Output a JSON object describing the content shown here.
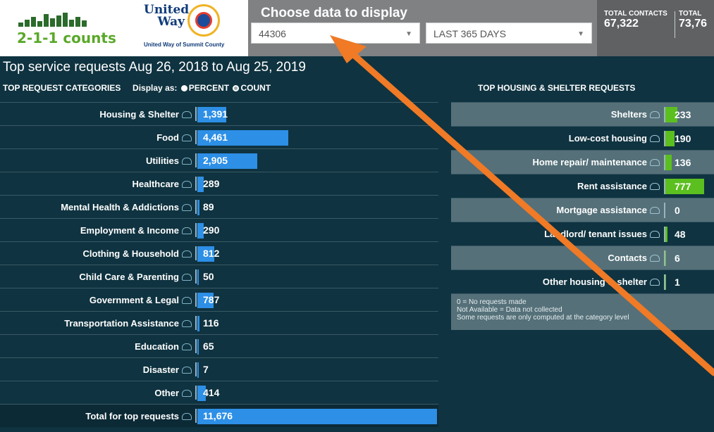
{
  "header": {
    "logo_text": "2-1-1 counts",
    "uw_line1": "United",
    "uw_line2": "Way",
    "uw_sub": "United Way of Summit County",
    "choose_title": "Choose data to display",
    "zip_value": "44306",
    "period_value": "LAST 365 DAYS",
    "totals": [
      {
        "label": "TOTAL CONTACTS",
        "value": "67,322"
      },
      {
        "label": "TOTAL",
        "value": "73,76"
      }
    ]
  },
  "section": {
    "title": "Top service requests Aug 26, 2018 to Aug 25, 2019",
    "categories_label": "TOP REQUEST CATEGORIES",
    "display_as": "Display as:",
    "percent": "PERCENT",
    "count": "COUNT",
    "housing_title": "TOP HOUSING & SHELTER REQUESTS"
  },
  "categories": [
    {
      "label": "Housing & Shelter",
      "value": "1,391",
      "bar": 0.12
    },
    {
      "label": "Food",
      "value": "4,461",
      "bar": 0.38
    },
    {
      "label": "Utilities",
      "value": "2,905",
      "bar": 0.25
    },
    {
      "label": "Healthcare",
      "value": "289",
      "bar": 0.025
    },
    {
      "label": "Mental Health & Addictions",
      "value": "89",
      "bar": 0.008
    },
    {
      "label": "Employment & Income",
      "value": "290",
      "bar": 0.025
    },
    {
      "label": "Clothing & Household",
      "value": "812",
      "bar": 0.07
    },
    {
      "label": "Child Care & Parenting",
      "value": "50",
      "bar": 0.004
    },
    {
      "label": "Government & Legal",
      "value": "787",
      "bar": 0.067
    },
    {
      "label": "Transportation Assistance",
      "value": "116",
      "bar": 0.01
    },
    {
      "label": "Education",
      "value": "65",
      "bar": 0.006
    },
    {
      "label": "Disaster",
      "value": "7",
      "bar": 0.001
    },
    {
      "label": "Other",
      "value": "414",
      "bar": 0.035
    },
    {
      "label": "Total for top requests",
      "value": "11,676",
      "bar": 1.0
    }
  ],
  "housing": [
    {
      "label": "Shelters",
      "value": "233",
      "bar": 0.3
    },
    {
      "label": "Low-cost housing",
      "value": "190",
      "bar": 0.24
    },
    {
      "label": "Home repair/ maintenance",
      "value": "136",
      "bar": 0.17
    },
    {
      "label": "Rent assistance",
      "value": "777",
      "bar": 1.0
    },
    {
      "label": "Mortgage assistance",
      "value": "0",
      "bar": 0
    },
    {
      "label": "Landlord/ tenant issues",
      "value": "48",
      "bar": 0.06
    },
    {
      "label": "Contacts",
      "value": "6",
      "bar": 0.01
    },
    {
      "label": "Other housing & shelter",
      "value": "1",
      "bar": 0.005
    }
  ],
  "notes": [
    "0 = No requests made",
    "Not Available = Data not collected",
    "Some requests are only computed at the category level"
  ],
  "colors": {
    "accent_blue": "#2d8fe6",
    "accent_green": "#5bbf1f",
    "arrow": "#f07a26",
    "bg": "#0f3340"
  }
}
